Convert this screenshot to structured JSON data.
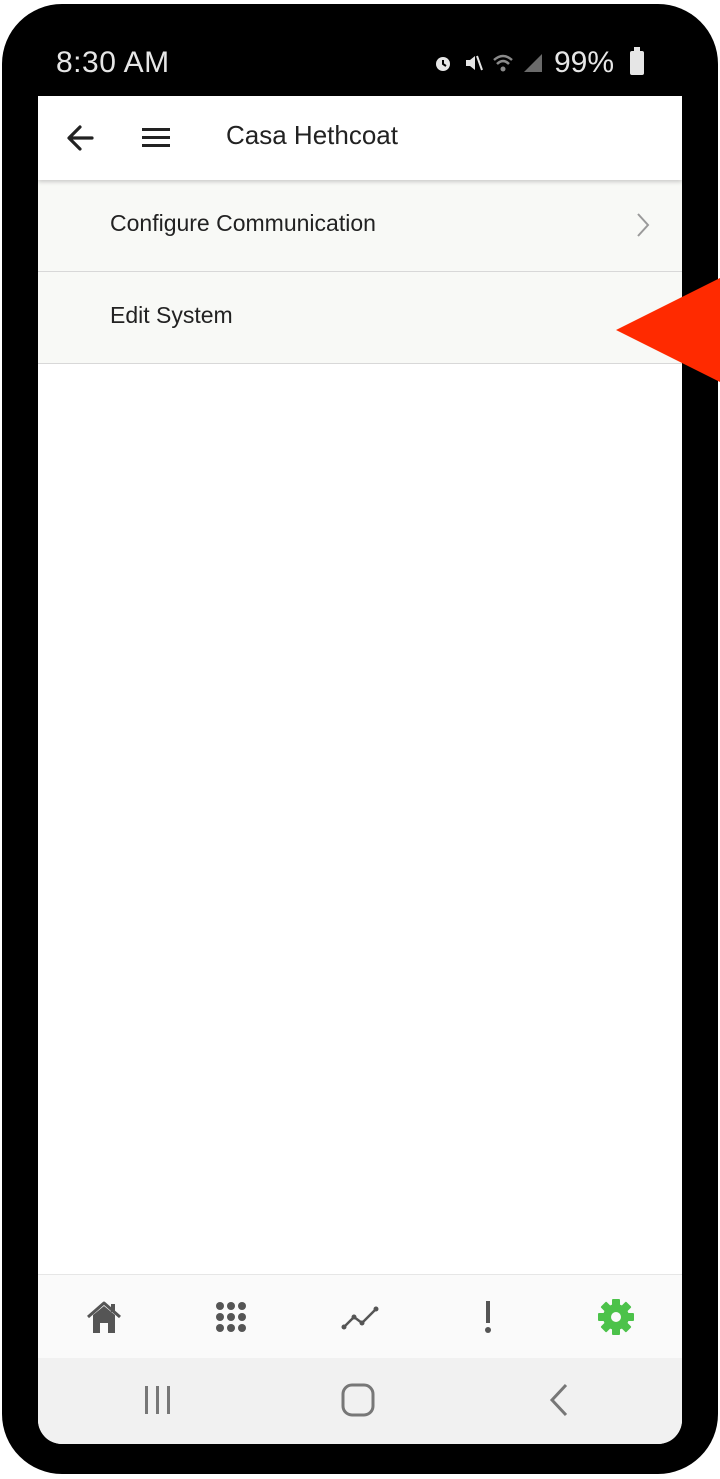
{
  "status_bar": {
    "time": "8:30 AM",
    "battery": "99%",
    "icons": [
      "alarm-icon",
      "mute-icon",
      "wifi-icon",
      "signal-icon",
      "battery-icon"
    ]
  },
  "app_bar": {
    "title": "Casa Hethcoat",
    "back_icon": "arrow-left-icon",
    "menu_icon": "hamburger-menu-icon"
  },
  "list": {
    "items": [
      {
        "label": "Configure Communication",
        "has_chevron": true
      },
      {
        "label": "Edit System",
        "has_chevron": false
      }
    ]
  },
  "bottom_nav": {
    "items": [
      {
        "icon": "home-icon",
        "active": false
      },
      {
        "icon": "grid-dots-icon",
        "active": false
      },
      {
        "icon": "trend-line-icon",
        "active": false
      },
      {
        "icon": "exclamation-icon",
        "active": false
      },
      {
        "icon": "gear-icon",
        "active": true
      }
    ],
    "active_color": "#4cc24a",
    "inactive_color": "#555555"
  },
  "system_nav": {
    "icons": [
      "recent-apps-icon",
      "home-button-icon",
      "back-chevron-icon"
    ]
  },
  "annotation": {
    "pointer_icon": "red-triangle-pointer",
    "color": "#ff2a00"
  }
}
